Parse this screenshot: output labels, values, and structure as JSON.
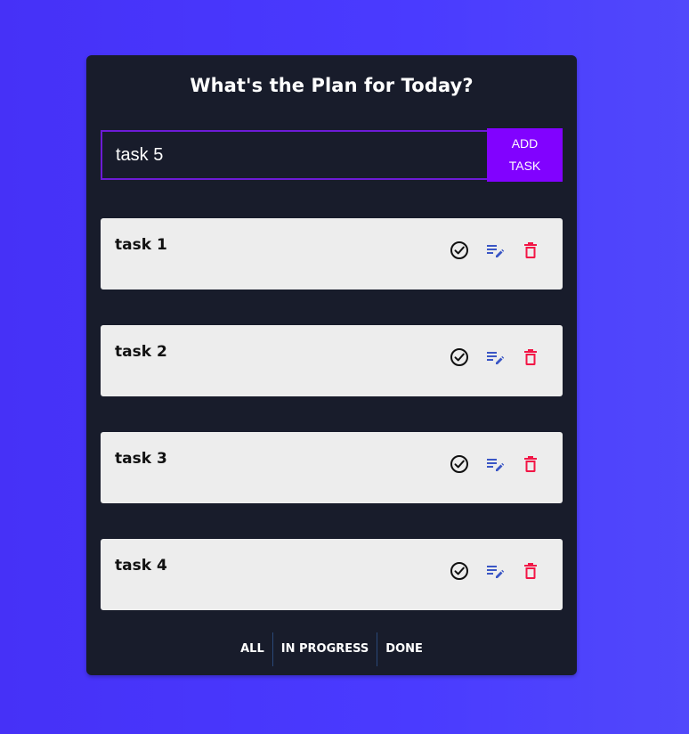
{
  "header": {
    "title": "What's the Plan for Today?"
  },
  "form": {
    "input_value": "task 5",
    "add_label_line1": "ADD",
    "add_label_line2": "TASK"
  },
  "tasks": [
    {
      "label": "task 1"
    },
    {
      "label": "task 2"
    },
    {
      "label": "task 3"
    },
    {
      "label": "task 4"
    }
  ],
  "task_icons": {
    "done": "check-circle-icon",
    "edit": "edit-list-icon",
    "delete": "trash-icon"
  },
  "filters": {
    "all": "ALL",
    "in_progress": "IN PROGRESS",
    "done": "DONE"
  },
  "colors": {
    "background": "#4631f7",
    "card": "#181c2b",
    "accent": "#8102ff",
    "input_border": "#6d1bd6",
    "task_bg": "#ededed",
    "edit_icon": "#3a56c5",
    "delete_icon": "#f21646"
  }
}
